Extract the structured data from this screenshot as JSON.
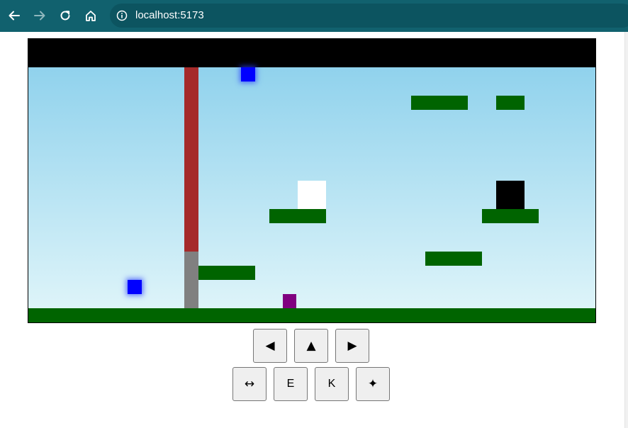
{
  "browser": {
    "url": "localhost:5173",
    "icons": {
      "back": "arrow-left-icon",
      "forward": "arrow-right-icon",
      "reload": "reload-icon",
      "home": "home-icon",
      "site_info": "info-icon"
    },
    "colors": {
      "toolbar": "#11616e",
      "urlbar": "#0c5460"
    }
  },
  "game": {
    "colors": {
      "sky_top": "#87ceeb",
      "sky_bottom": "#e2f6fa",
      "hud": "#000000",
      "platform": "#006400",
      "wall": "#a52a2a",
      "wall_base": "#808080",
      "gem": "#0000ff",
      "player": "#800080",
      "door_white": "#ffffff",
      "door_black": "#000000"
    }
  },
  "controls": {
    "row1": [
      {
        "label": "◀",
        "name": "move-left-button"
      },
      {
        "label": "▲",
        "name": "jump-button"
      },
      {
        "label": "▶",
        "name": "move-right-button"
      }
    ],
    "row2": [
      {
        "label": "↔",
        "name": "swap-button"
      },
      {
        "label": "E",
        "name": "e-button"
      },
      {
        "label": "K",
        "name": "k-button"
      },
      {
        "label": "✦",
        "name": "special-button"
      }
    ]
  }
}
